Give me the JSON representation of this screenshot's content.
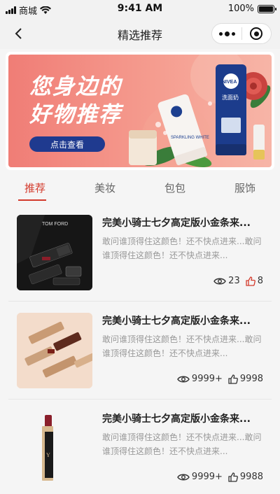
{
  "status_bar": {
    "carrier": "商城",
    "time": "9:41 AM",
    "battery_pct": "100%"
  },
  "nav": {
    "title": "精选推荐"
  },
  "banner": {
    "headline_line1": "您身边的",
    "headline_line2": "好物推荐",
    "cta_label": "点击查看",
    "product_text_1": "NIVEA",
    "product_text_2": "SPARKLING WHITE",
    "product_text_3": "洗面奶",
    "colors": {
      "primary": "#f07d76",
      "cta": "#1f3a8f"
    }
  },
  "tabs": [
    {
      "label": "推荐",
      "active": true
    },
    {
      "label": "美妆",
      "active": false
    },
    {
      "label": "包包",
      "active": false
    },
    {
      "label": "服饰",
      "active": false
    }
  ],
  "items": [
    {
      "title": "完美小骑士七夕高定版小金条来...",
      "desc": "敢问谁顶得住这颜色！还不快点进来...敢问谁顶得住这颜色！还不快点进来...",
      "image_text": "TOM FORD",
      "views": "23",
      "likes": "8",
      "liked": true
    },
    {
      "title": "完美小骑士七夕高定版小金条来...",
      "desc": "敢问谁顶得住这颜色！还不快点进来...敢问谁顶得住这颜色！还不快点进来...",
      "views": "9999+",
      "likes": "9998",
      "liked": false
    },
    {
      "title": "完美小骑士七夕高定版小金条来...",
      "desc": "敢问谁顶得住这颜色！还不快点进来...敢问谁顶得住这颜色！还不快点进来...",
      "views": "9999+",
      "likes": "9988",
      "liked": false
    }
  ]
}
